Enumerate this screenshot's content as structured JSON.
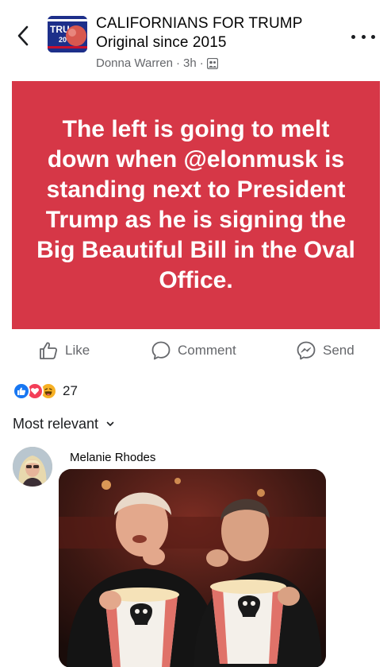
{
  "header": {
    "group_name_line1": "CALIFORNIANS FOR TRUMP",
    "group_name_line2": "Original since 2015",
    "author": "Donna Warren",
    "separator": "·",
    "time": "3h",
    "separator2": "·",
    "avatar_text": "TRU",
    "avatar_number": "20"
  },
  "post": {
    "text": "The left is going to melt down when @elonmusk is standing next to President Trump as he is signing the Big Beautiful Bill in the Oval Office.",
    "background_color": "#d63747"
  },
  "actions": {
    "like_label": "Like",
    "comment_label": "Comment",
    "send_label": "Send"
  },
  "reactions": {
    "types": [
      "like",
      "love",
      "haha"
    ],
    "count": "27"
  },
  "comments": {
    "sort_label": "Most relevant",
    "items": [
      {
        "author": "Melanie Rhodes",
        "has_image": true
      }
    ]
  },
  "colors": {
    "accent": "#1877f2",
    "love": "#f33e58",
    "haha": "#f7b125",
    "secondary_text": "#65676b"
  }
}
